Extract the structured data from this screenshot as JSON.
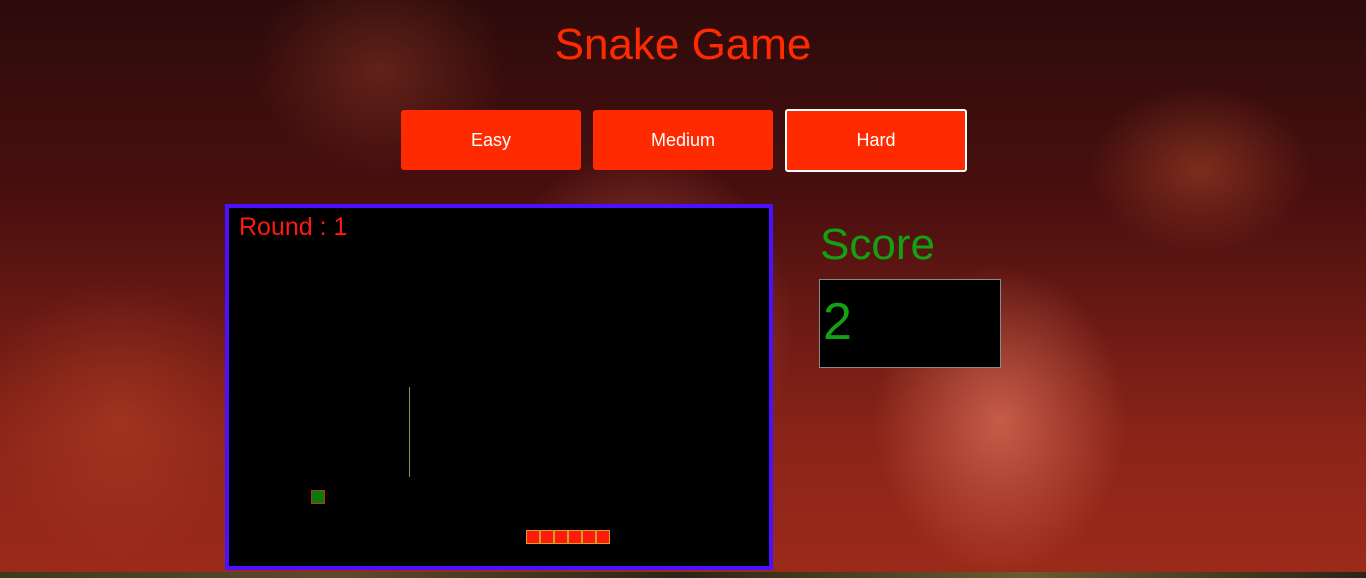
{
  "title": "Snake Game",
  "difficulty": {
    "easy_label": "Easy",
    "medium_label": "Medium",
    "hard_label": "Hard",
    "selected": "Hard"
  },
  "game": {
    "round_text": "Round : 1",
    "snake_length": 6
  },
  "score": {
    "label": "Score",
    "value": "2"
  },
  "colors": {
    "accent": "#ff2a00",
    "board_border": "#4a10ff",
    "score_text": "#13a013",
    "snake": "#ff1a10",
    "food": "#0a7a0a"
  }
}
